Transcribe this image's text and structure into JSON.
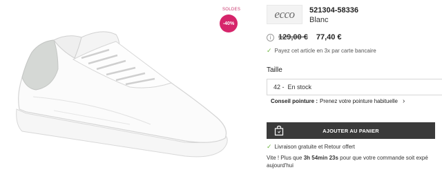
{
  "gallery": {
    "soldes_label": "SOLDES",
    "discount_badge": "-40%"
  },
  "product": {
    "brand_logo": "ecco",
    "reference": "521304-58336",
    "color": "Blanc",
    "old_price": "129,00 €",
    "new_price": "77,40 €",
    "payment_note": "Payez cet article en 3x par carte bancaire",
    "size_label": "Taille",
    "size_value": "42 -",
    "stock_status": "En stock",
    "conseil_title": "Conseil pointure :",
    "conseil_text": "Prenez votre pointure habituelle",
    "cart_button_label": "AJOUTER AU PANIER",
    "delivery_note": "Livraison gratuite et Retour offert",
    "urgency_prefix": "Vite ! Plus que",
    "urgency_time": "3h 54min 23s",
    "urgency_suffix": "pour que votre commande soit expé",
    "urgency_line2": "aujourd'hui"
  },
  "colors": {
    "accent_pink": "#d6256b",
    "button_dark": "#3a3a3a",
    "check_green": "#6cb33f"
  },
  "icons": [
    "info-icon",
    "check-icon",
    "chevron-right-icon",
    "shopping-bag-icon"
  ]
}
